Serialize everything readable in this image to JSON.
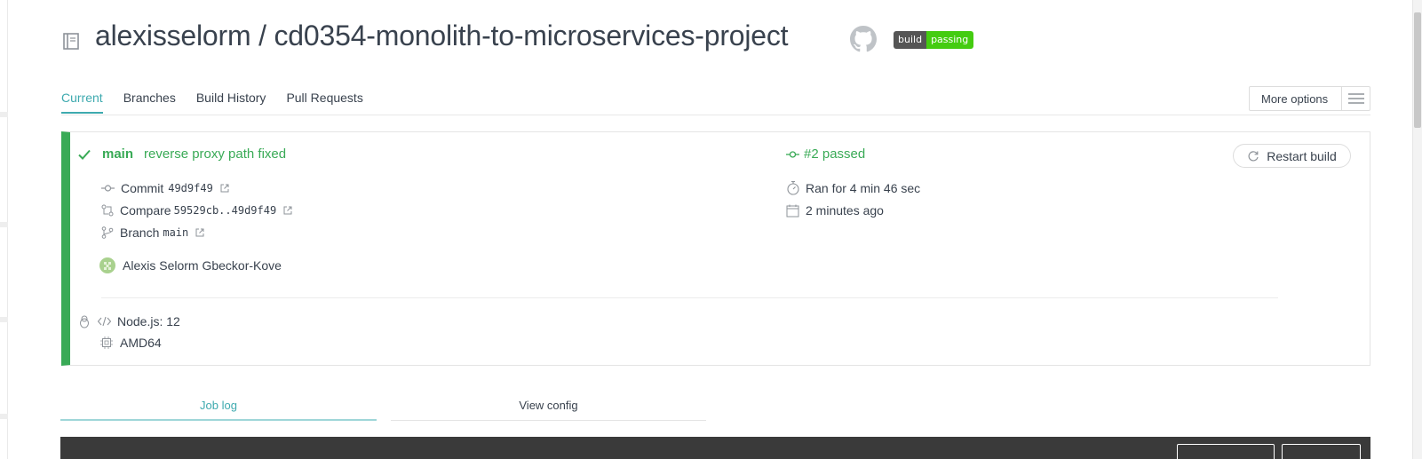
{
  "header": {
    "repo_title": "alexisselorm / cd0354-monolith-to-microservices-project",
    "badge_left": "build",
    "badge_right": "passing"
  },
  "tabs": [
    {
      "label": "Current",
      "active": true
    },
    {
      "label": "Branches",
      "active": false
    },
    {
      "label": "Build History",
      "active": false
    },
    {
      "label": "Pull Requests",
      "active": false
    }
  ],
  "more_options": "More options",
  "build": {
    "branch": "main",
    "message": "reverse proxy path fixed",
    "status": "#2 passed",
    "restart_label": "Restart build",
    "commit_label": "Commit",
    "commit_hash": "49d9f49",
    "compare_label": "Compare",
    "compare_range": "59529cb..49d9f49",
    "branch_label": "Branch",
    "branch_name": "main",
    "author": "Alexis Selorm Gbeckor-Kove",
    "duration": "Ran for 4 min 46 sec",
    "finished": "2 minutes ago",
    "language": "Node.js: 12",
    "arch": "AMD64",
    "status_color": "#39aa56"
  },
  "job_tabs": {
    "job_log": "Job log",
    "view_config": "View config"
  },
  "colors": {
    "accent": "#3eaaaf",
    "passed": "#39aa56",
    "badge_passing": "#44cc11"
  }
}
